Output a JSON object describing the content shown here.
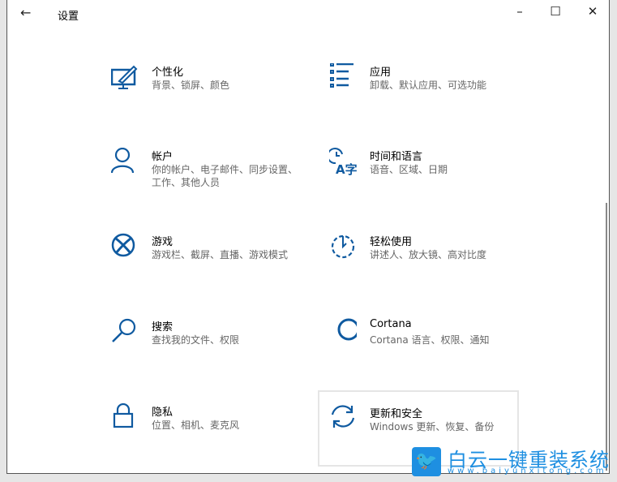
{
  "window": {
    "title": "设置",
    "back": "←",
    "minimize": "–",
    "maximize": "☐",
    "close": "✕"
  },
  "items": [
    {
      "title": "个性化",
      "sub": "背景、锁屏、颜色",
      "icon": "personalization-icon"
    },
    {
      "title": "应用",
      "sub": "卸载、默认应用、可选功能",
      "icon": "apps-icon"
    },
    {
      "title": "帐户",
      "sub": "你的帐户、电子邮件、同步设置、工作、其他人员",
      "icon": "account-icon"
    },
    {
      "title": "时间和语言",
      "sub": "语音、区域、日期",
      "icon": "time-language-icon"
    },
    {
      "title": "游戏",
      "sub": "游戏栏、截屏、直播、游戏模式",
      "icon": "xbox-icon"
    },
    {
      "title": "轻松使用",
      "sub": "讲述人、放大镜、高对比度",
      "icon": "ease-of-access-icon"
    },
    {
      "title": "搜索",
      "sub": "查找我的文件、权限",
      "icon": "search-icon"
    },
    {
      "title": "Cortana",
      "sub": "Cortana 语言、权限、通知",
      "icon": "cortana-icon"
    },
    {
      "title": "隐私",
      "sub": "位置、相机、麦克风",
      "icon": "lock-icon"
    },
    {
      "title": "更新和安全",
      "sub": "Windows 更新、恢复、备份",
      "icon": "update-icon"
    }
  ],
  "watermark": {
    "name": "白云一键重装系统",
    "url": "www.baiyunxitong.com"
  },
  "accent": "#0f5aa0"
}
